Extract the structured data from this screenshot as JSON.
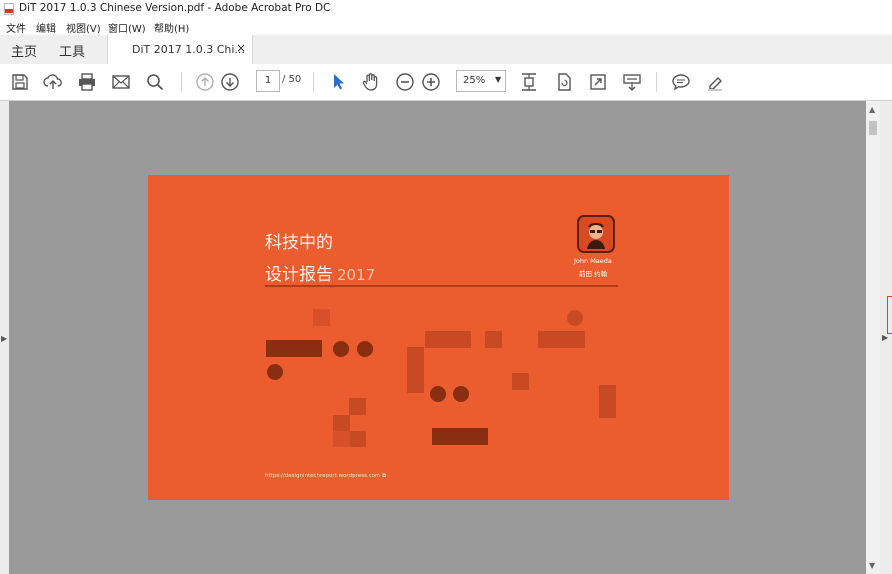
{
  "window": {
    "title": "DiT 2017 1.0.3 Chinese Version.pdf - Adobe Acrobat Pro DC"
  },
  "menu": {
    "items": [
      "文件",
      "编辑",
      "视图(V)",
      "窗口(W)",
      "帮助(H)"
    ]
  },
  "tabs": {
    "home": "主页",
    "tools": "工具",
    "document": "DiT 2017 1.0.3 Chi...",
    "close_glyph": "×"
  },
  "toolbar": {
    "icons": [
      "save-icon",
      "upload-cloud-icon",
      "print-icon",
      "mail-icon",
      "search-icon",
      "previous-page-icon",
      "next-page-icon",
      "select-cursor-icon",
      "hand-tool-icon",
      "zoom-out-icon",
      "zoom-in-icon",
      "fit-page-icon",
      "rotate-page-icon",
      "full-screen-icon",
      "read-mode-icon",
      "comment-icon",
      "highlight-pen-icon"
    ],
    "page_current": "1",
    "page_total": "/ 50",
    "zoom": "25%"
  },
  "document": {
    "title_line1": "科技中的",
    "title_line2": "设计报告",
    "year": "2017",
    "author_en": "John Maeda",
    "author_zh": "前田 约翰",
    "url": "https://designintechreport.wordpress.com",
    "colors": {
      "background": "#eb5c2f",
      "dark": "#8a2e12",
      "mid": "#c84a24",
      "light": "#e07a57"
    }
  }
}
